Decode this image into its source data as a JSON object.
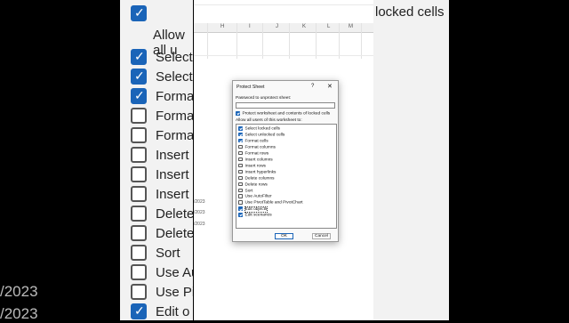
{
  "background": {
    "left_dates": [
      "/2023",
      "/2023"
    ],
    "zoom_top": "Allow all u",
    "zoom_items": [
      {
        "label": "Select",
        "checked": true
      },
      {
        "label": "Select",
        "checked": true
      },
      {
        "label": "Forma",
        "checked": true
      },
      {
        "label": "Forma",
        "checked": false
      },
      {
        "label": "Forma",
        "checked": false
      },
      {
        "label": "Insert",
        "checked": false
      },
      {
        "label": "Insert",
        "checked": false
      },
      {
        "label": "Insert",
        "checked": false
      },
      {
        "label": "Delete",
        "checked": false
      },
      {
        "label": "Delete",
        "checked": false
      },
      {
        "label": "Sort",
        "checked": false
      },
      {
        "label": "Use Au",
        "checked": false
      },
      {
        "label": "Use Pi",
        "checked": false
      },
      {
        "label": "Edit o",
        "checked": true
      }
    ],
    "right_text": "locked cells"
  },
  "sheet": {
    "columns": [
      "H",
      "I",
      "J",
      "K",
      "L",
      "M"
    ],
    "dates": [
      "/2023",
      "/2023",
      "/2023"
    ]
  },
  "dialog": {
    "title": "Protect Sheet",
    "help": "?",
    "close": "✕",
    "password_label": "Password to unprotect sheet:",
    "password_value": "",
    "protect_label": "Protect worksheet and contents of locked cells",
    "protect_checked": true,
    "allow_label": "Allow all users of this worksheet to:",
    "items": [
      {
        "label": "Select locked cells",
        "checked": true
      },
      {
        "label": "Select unlocked cells",
        "checked": true
      },
      {
        "label": "Format cells",
        "checked": true
      },
      {
        "label": "Format columns",
        "checked": false
      },
      {
        "label": "Format rows",
        "checked": false
      },
      {
        "label": "Insert columns",
        "checked": false
      },
      {
        "label": "Insert rows",
        "checked": false
      },
      {
        "label": "Insert hyperlinks",
        "checked": false
      },
      {
        "label": "Delete columns",
        "checked": false
      },
      {
        "label": "Delete rows",
        "checked": false
      },
      {
        "label": "Sort",
        "checked": false
      },
      {
        "label": "Use AutoFilter",
        "checked": false
      },
      {
        "label": "Use PivotTable and PivotChart",
        "checked": false
      },
      {
        "label": "Edit objects",
        "checked": true
      },
      {
        "label": "Edit scenarios",
        "checked": true
      }
    ],
    "ok_label": "OK",
    "cancel_label": "Cancel"
  }
}
